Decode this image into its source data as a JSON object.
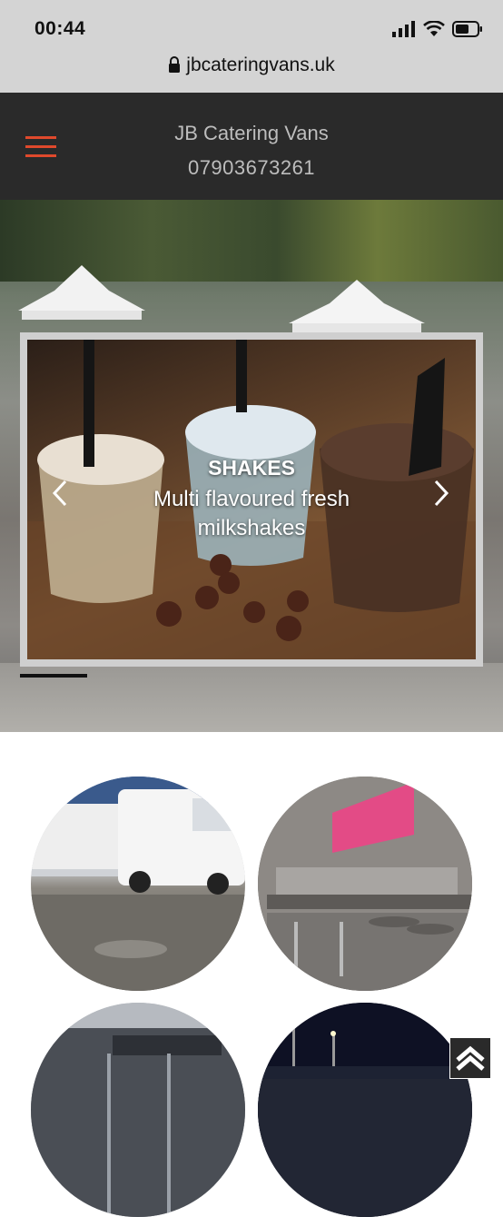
{
  "status_bar": {
    "time": "00:44",
    "icons": [
      "signal-icon",
      "wifi-icon",
      "battery-icon"
    ]
  },
  "browser": {
    "url": "jbcateringvans.uk",
    "lock_icon": "lock-icon"
  },
  "header": {
    "title": "JB Catering Vans",
    "phone": "07903673261",
    "menu_icon": "hamburger-menu-icon",
    "accent_color": "#e0492c",
    "background": "#2a2a2a"
  },
  "hero_slider": {
    "slide": {
      "title": "SHAKES",
      "text": "Multi flavoured  fresh milkshakes"
    },
    "prev_icon": "chevron-left-icon",
    "next_icon": "chevron-right-icon"
  },
  "gallery": {
    "items": [
      {
        "name": "white-vans-photo"
      },
      {
        "name": "stainless-kitchen-photo"
      },
      {
        "name": "grey-trailer-photo"
      },
      {
        "name": "night-stadium-photo"
      }
    ]
  },
  "back_to_top": {
    "icon": "chevron-up-icon"
  }
}
